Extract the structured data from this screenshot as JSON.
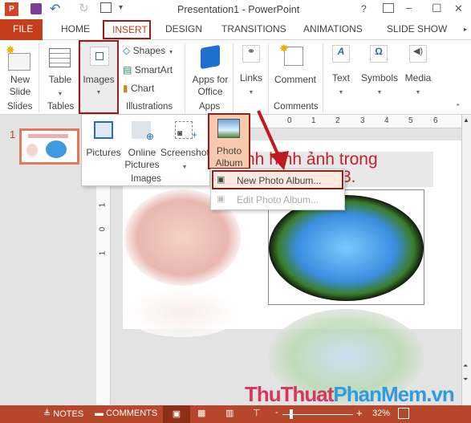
{
  "window": {
    "title": "Presentation1 - PowerPoint",
    "help": "?",
    "minimize": "–",
    "maximize": "☐",
    "close": "✕"
  },
  "tabs": [
    {
      "label": "FILE"
    },
    {
      "label": "HOME"
    },
    {
      "label": "INSERT",
      "active": true
    },
    {
      "label": "DESIGN"
    },
    {
      "label": "TRANSITIONS"
    },
    {
      "label": "ANIMATIONS"
    },
    {
      "label": "SLIDE SHOW"
    }
  ],
  "ribbon": {
    "new_slide": "New Slide",
    "table": "Table",
    "images": "Images",
    "shapes": "Shapes",
    "smartart": "SmartArt",
    "chart": "Chart",
    "apps_for_office": "Apps for Office",
    "links": "Links",
    "comment": "Comment",
    "text": "Text",
    "symbols": "Symbols",
    "media": "Media",
    "groups": {
      "slides": "Slides",
      "tables": "Tables",
      "illustrations": "Illustrations",
      "apps": "Apps",
      "comments": "Comments"
    }
  },
  "images_panel": {
    "pictures": "Pictures",
    "online_pictures": "Online Pictures",
    "screenshot": "Screenshot",
    "photo_album": "Photo Album",
    "group": "Images"
  },
  "photo_album_menu": [
    {
      "label": "New Photo Album...",
      "enabled": true
    },
    {
      "label": "Edit Photo Album...",
      "enabled": false
    }
  ],
  "thumbnail": {
    "number": "1"
  },
  "ruler": {
    "h": [
      "0",
      "1",
      "2",
      "3",
      "4",
      "5",
      "6"
    ],
    "v": [
      "1",
      "0",
      "1"
    ]
  },
  "slide": {
    "title_line1": "nh hình ảnh trong",
    "title_line2": "3."
  },
  "watermark": {
    "part1": "ThuThuat",
    "part2": "PhanMem.vn"
  },
  "statusbar": {
    "notes": "NOTES",
    "comments": "COMMENTS",
    "zoom": "32%",
    "zoom_level": 32
  },
  "colors": {
    "accent": "#b7472a",
    "highlight_border": "#9b1c1c",
    "arrow": "#c0181c"
  }
}
